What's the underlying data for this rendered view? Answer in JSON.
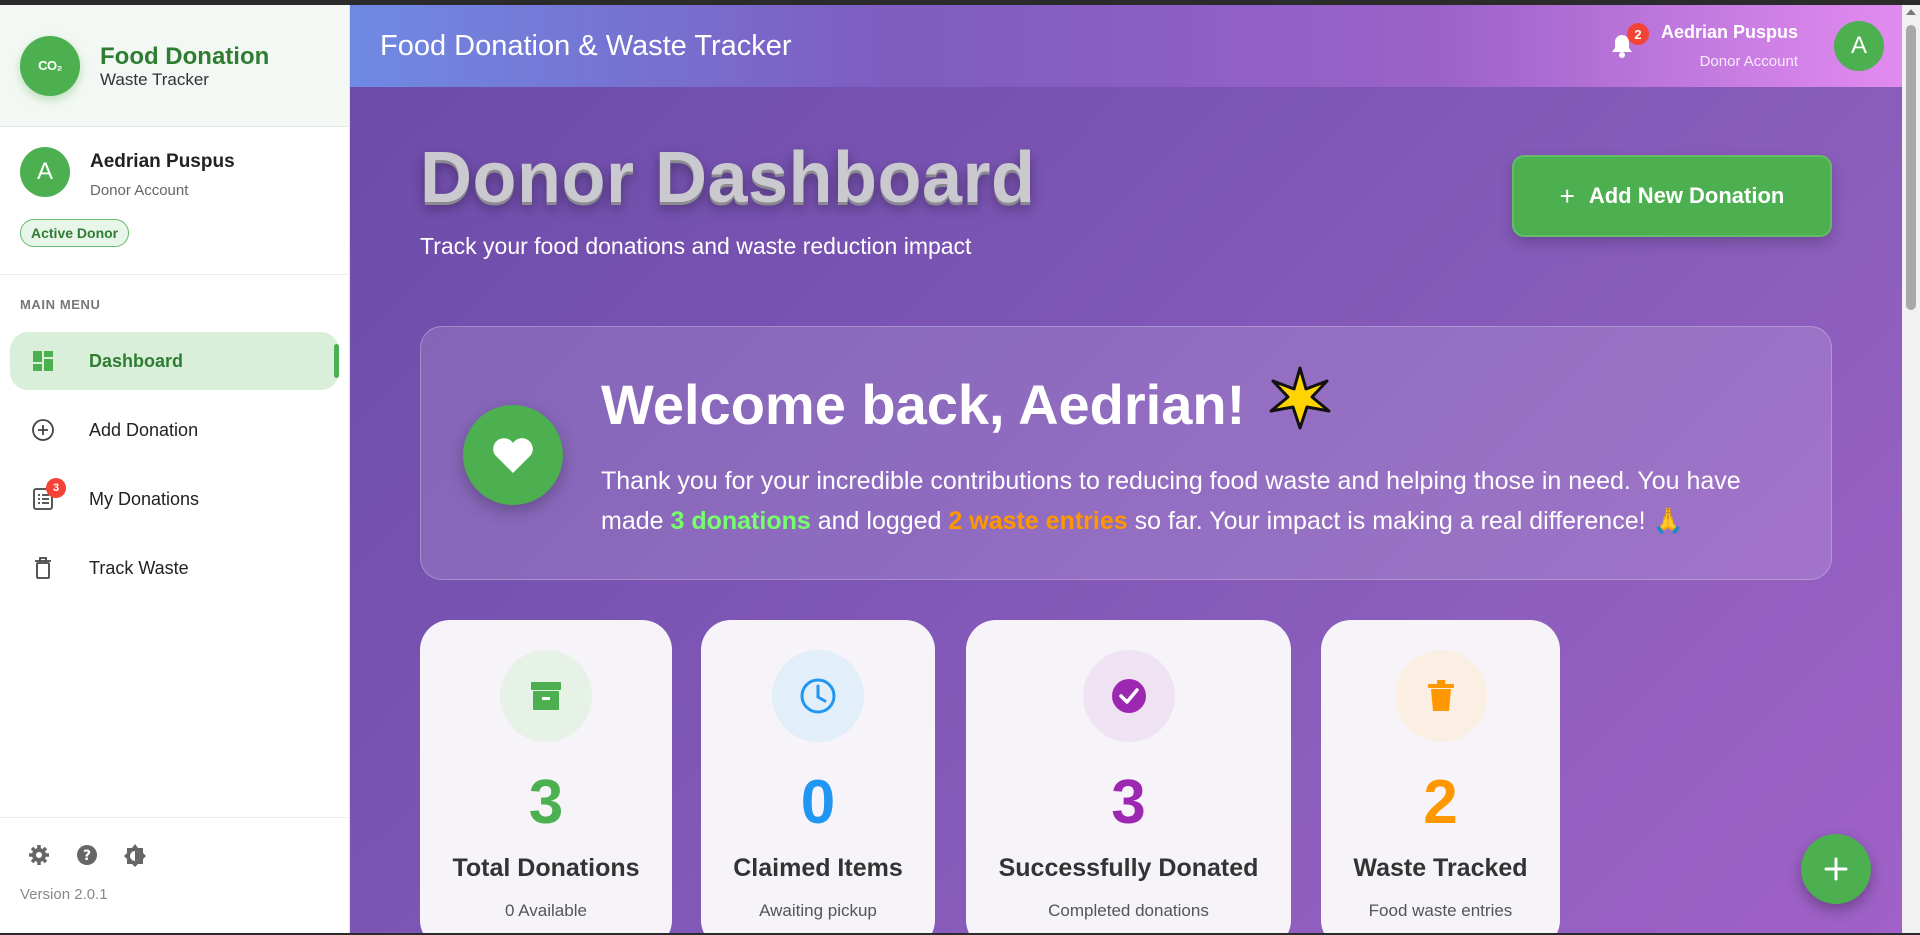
{
  "brand": {
    "logo_text": "CO₂",
    "title": "Food Donation",
    "subtitle": "Waste Tracker"
  },
  "sidebar_user": {
    "initial": "A",
    "name": "Aedrian Puspus",
    "role": "Donor Account",
    "badge": "Active Donor"
  },
  "menu": {
    "heading": "MAIN MENU",
    "items": [
      {
        "label": "Dashboard",
        "icon": "dashboard-icon",
        "active": true
      },
      {
        "label": "Add Donation",
        "icon": "add-circle-icon"
      },
      {
        "label": "My Donations",
        "icon": "list-icon",
        "badge": "3"
      },
      {
        "label": "Track Waste",
        "icon": "trash-icon"
      }
    ]
  },
  "footer": {
    "version": "Version 2.0.1"
  },
  "header": {
    "title": "Food Donation & Waste Tracker",
    "notification_count": "2",
    "user_name": "Aedrian Puspus",
    "user_role": "Donor Account",
    "user_initial": "A"
  },
  "page": {
    "title": "Donor Dashboard",
    "subtitle": "Track your food donations and waste reduction impact",
    "add_button_label": "Add New Donation"
  },
  "welcome": {
    "title": "Welcome back, Aedrian!",
    "text_1": "Thank you for your incredible contributions to reducing food waste and helping those in need. You have made ",
    "donations_highlight": "3 donations",
    "text_2": " and logged ",
    "waste_highlight": "2 waste entries",
    "text_3": " so far. Your impact is making a real difference! ",
    "emoji": "🙏"
  },
  "stats": [
    {
      "value": "3",
      "label": "Total Donations",
      "desc": "0 Available",
      "color": "#4caf50",
      "icon": "archive-box-icon"
    },
    {
      "value": "0",
      "label": "Claimed Items",
      "desc": "Awaiting pickup",
      "color": "#2196f3",
      "icon": "clock-icon"
    },
    {
      "value": "3",
      "label": "Successfully Donated",
      "desc": "Completed donations",
      "color": "#9c27b0",
      "icon": "check-circle-icon"
    },
    {
      "value": "2",
      "label": "Waste Tracked",
      "desc": "Food waste entries",
      "color": "#ff9800",
      "icon": "trash-icon"
    }
  ],
  "colors": {
    "primary_green": "#4caf50",
    "accent_orange": "#ff9800",
    "header_gradient_start": "#6f8ae3",
    "header_gradient_end": "#e28bf0"
  }
}
